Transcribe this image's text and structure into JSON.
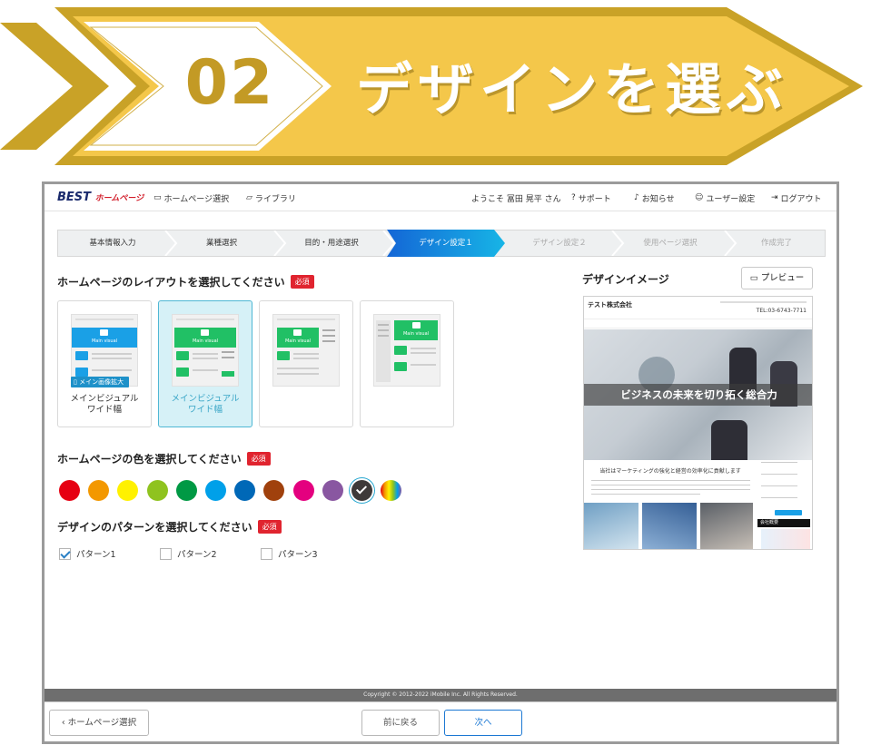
{
  "banner": {
    "number": "02",
    "title": "デザインを選ぶ"
  },
  "header": {
    "logo_main": "BEST",
    "logo_sub": "ホームページ",
    "nav": [
      "ホームページ選択",
      "ライブラリ"
    ],
    "greeting": "ようこそ 冨田 晃平 さん",
    "menu": [
      "サポート",
      "お知らせ",
      "ユーザー設定",
      "ログアウト"
    ]
  },
  "steps": [
    "基本情報入力",
    "業種選択",
    "目的・用途選択",
    "デザイン設定１",
    "デザイン設定２",
    "使用ページ選択",
    "作成完了"
  ],
  "layout_section": {
    "title": "ホームページのレイアウトを選択してください",
    "required": "必須",
    "main_visual_text": "Main visual",
    "expand_badge": "メイン画像拡大",
    "cards": [
      {
        "label1": "メインビジュアル",
        "label2": "ワイド幅"
      },
      {
        "label1": "メインビジュアル",
        "label2": "ワイド幅"
      },
      {
        "label1": "",
        "label2": ""
      },
      {
        "label1": "",
        "label2": ""
      }
    ]
  },
  "color_section": {
    "title": "ホームページの色を選択してください",
    "required": "必須",
    "colors": [
      "#e60012",
      "#f39800",
      "#fff100",
      "#8fc31f",
      "#009944",
      "#00a0e9",
      "#0068b7",
      "#a0410d",
      "#e4007f",
      "#8957a1",
      "#3e3a39",
      "rainbow"
    ],
    "selected_index": 10
  },
  "pattern_section": {
    "title": "デザインのパターンを選択してください",
    "required": "必須",
    "options": [
      "パターン1",
      "パターン2",
      "パターン3"
    ],
    "checked_index": 0
  },
  "preview": {
    "title": "デザインイメージ",
    "button": "プレビュー",
    "company": "テスト株式会社",
    "phone": "TEL:03-6743-7711",
    "hero_text": "ビジネスの未来を切り拓く総合力",
    "subhead": "当社はマーケティングの強化と経営の効率化に貢献します",
    "side_label": "会社概要"
  },
  "footer": {
    "copyright": "Copyright © 2012-2022 iMobile Inc. All Rights Reserved."
  },
  "bottom": {
    "back_home": "ホームページ選択",
    "prev": "前に戻る",
    "next": "次へ"
  }
}
